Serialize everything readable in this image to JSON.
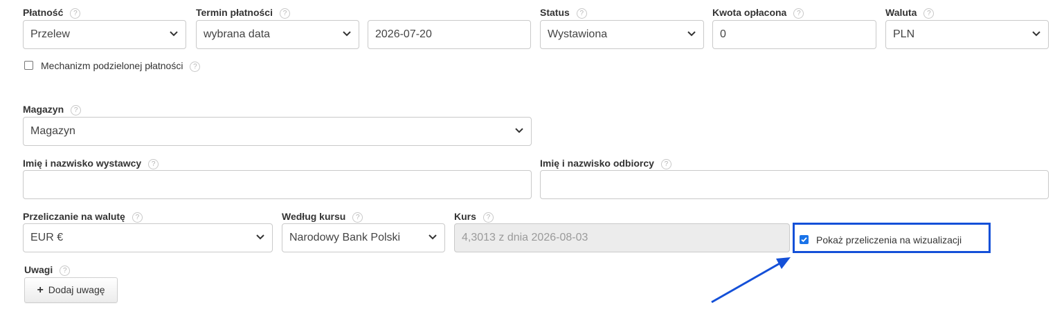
{
  "help_glyph": "?",
  "payment": {
    "label": "Płatność",
    "value": "Przelew"
  },
  "payment_term": {
    "label": "Termin płatności",
    "value": "wybrana data",
    "date": "2026-07-20"
  },
  "status": {
    "label": "Status",
    "value": "Wystawiona"
  },
  "amount_paid": {
    "label": "Kwota opłacona",
    "value": "0"
  },
  "currency": {
    "label": "Waluta",
    "value": "PLN"
  },
  "split_payment": {
    "label": "Mechanizm podzielonej płatności",
    "checked": false
  },
  "warehouse": {
    "label": "Magazyn",
    "value": "Magazyn"
  },
  "issuer_name": {
    "label": "Imię i nazwisko wystawcy",
    "value": ""
  },
  "recipient_name": {
    "label": "Imię i nazwisko odbiorcy",
    "value": ""
  },
  "convert_currency": {
    "label": "Przeliczanie na walutę",
    "value": "EUR €"
  },
  "exchange_source": {
    "label": "Według kursu",
    "value": "Narodowy Bank Polski"
  },
  "rate": {
    "label": "Kurs",
    "value": "4,3013 z dnia 2026-08-03"
  },
  "show_conversion": {
    "label": "Pokaż przeliczenia na wizualizacji",
    "checked": true
  },
  "notes": {
    "label": "Uwagi",
    "button_label": "Dodaj uwagę",
    "button_icon": "plus-icon"
  },
  "colors": {
    "highlight": "#1450d8",
    "arrow": "#1450d8",
    "checkbox": "#1a73e8"
  }
}
